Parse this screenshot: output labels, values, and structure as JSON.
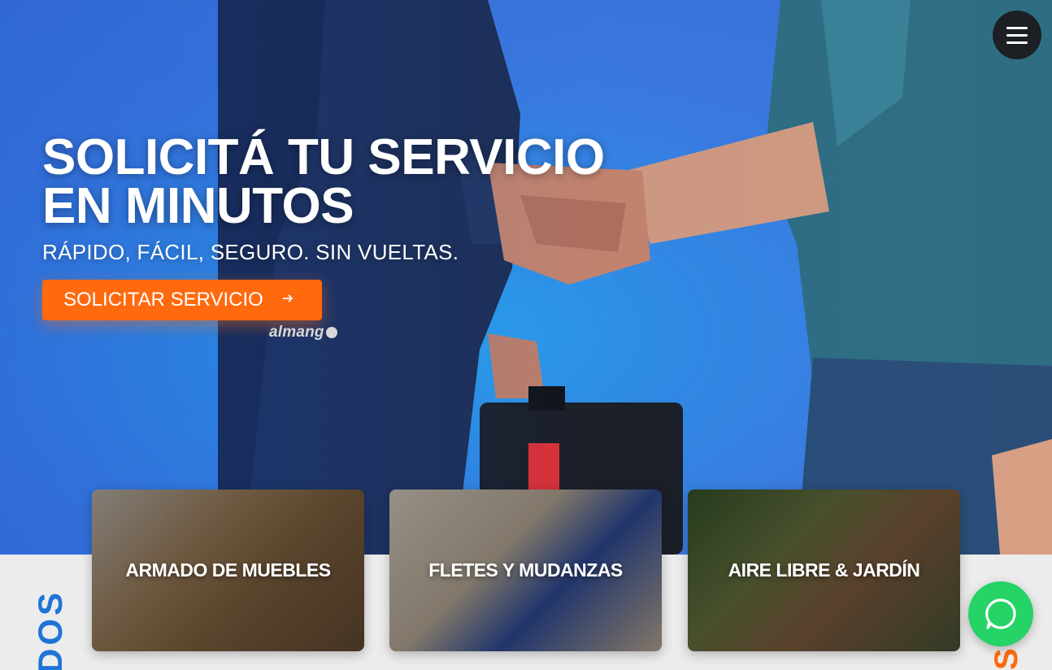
{
  "hero": {
    "headline_line1": "SOLICITÁ TU SERVICIO",
    "headline_line2": "EN MINUTOS",
    "subheadline": "RÁPIDO, FÁCIL, SEGURO. SIN VUELTAS.",
    "cta_label": "SOLICITAR SERVICIO",
    "cta_icon": "arrow-right-icon",
    "brand": "almang"
  },
  "header": {
    "menu_icon": "hamburger-menu-icon"
  },
  "services": [
    {
      "label": "ARMADO DE MUEBLES"
    },
    {
      "label": "FLETES Y MUDANZAS"
    },
    {
      "label": "AIRE LIBRE & JARDÍN"
    }
  ],
  "side_text": {
    "left": "DOS",
    "right": "S"
  },
  "whatsapp": {
    "icon": "whatsapp-icon"
  },
  "colors": {
    "accent": "#ff6a0e",
    "primary_blue": "#1f74d6",
    "whatsapp": "#25d366",
    "hero_blue": "#3b7be0"
  }
}
